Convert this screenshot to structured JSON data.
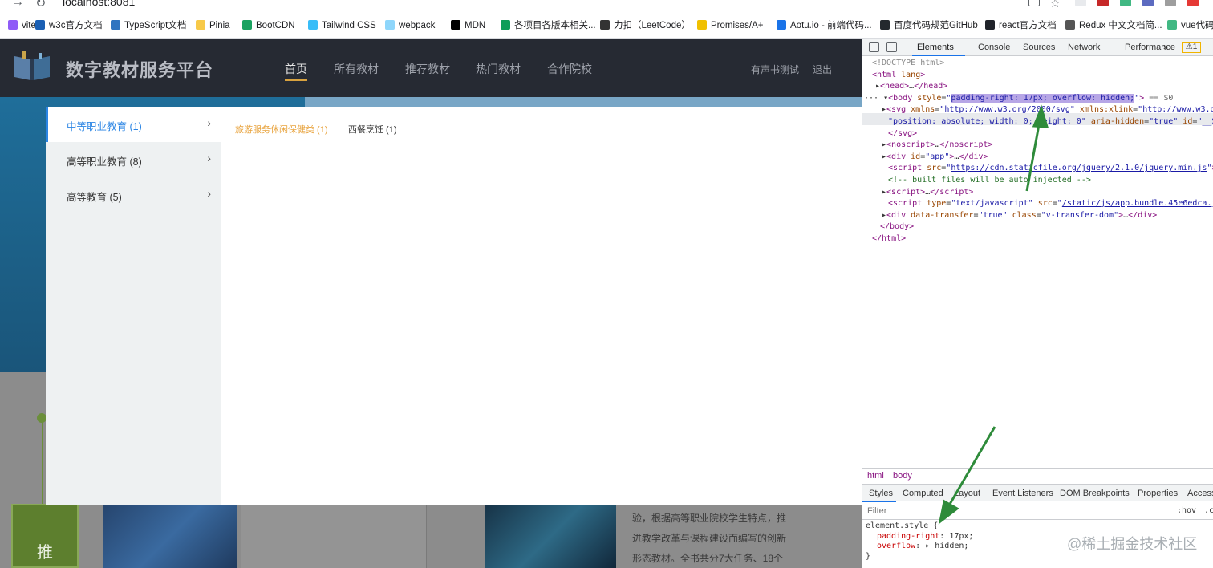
{
  "browser": {
    "url": "localhost:8081",
    "bookmarks": [
      {
        "label": "vite",
        "icon": "vite-icon",
        "color": "#8f5cf7"
      },
      {
        "label": "w3c官方文档",
        "icon": "w3c-icon",
        "color": "#1a5fb4"
      },
      {
        "label": "TypeScript文档",
        "icon": "typescript-icon",
        "color": "#2f74c0"
      },
      {
        "label": "Pinia",
        "icon": "pinia-icon",
        "color": "#f7c948"
      },
      {
        "label": "BootCDN",
        "icon": "bootcdn-icon",
        "color": "#1aa260"
      },
      {
        "label": "Tailwind CSS",
        "icon": "tailwind-icon",
        "color": "#38bdf8"
      },
      {
        "label": "webpack",
        "icon": "webpack-icon",
        "color": "#8ed6fb"
      },
      {
        "label": "MDN",
        "icon": "mdn-icon",
        "color": "#000000"
      },
      {
        "label": "各项目各版本相关...",
        "icon": "sheet-icon",
        "color": "#0f9d58"
      },
      {
        "label": "力扣（LeetCode）",
        "icon": "leetcode-icon",
        "color": "#333333"
      },
      {
        "label": "Promises/A+",
        "icon": "promises-icon",
        "color": "#f0c000"
      },
      {
        "label": "Aotu.io - 前端代码...",
        "icon": "aotu-icon",
        "color": "#1a73e8"
      },
      {
        "label": "百度代码规范GitHub",
        "icon": "github-icon",
        "color": "#24292e"
      },
      {
        "label": "react官方文档",
        "icon": "react-icon",
        "color": "#20232a"
      },
      {
        "label": "Redux 中文文档简...",
        "icon": "redux-icon",
        "color": "#555555"
      },
      {
        "label": "vue代码",
        "icon": "vue-icon",
        "color": "#41b883"
      }
    ]
  },
  "site": {
    "title": "数字教材服务平台",
    "nav": [
      "首页",
      "所有教材",
      "推荐教材",
      "热门教材",
      "合作院校"
    ],
    "user": "有声书测试",
    "logout": "退出"
  },
  "menu": {
    "categories": [
      {
        "label": "中等职业教育 (1)",
        "arrow": "›"
      },
      {
        "label": "高等职业教育 (8)",
        "arrow": "›"
      },
      {
        "label": "高等教育 (5)",
        "arrow": "›"
      }
    ],
    "subcategories": [
      "旅游服务休闲保健类 (1)",
      "西餐烹饪 (1)"
    ]
  },
  "background": {
    "badge": "推",
    "desc_lines": [
      "验，根据高等职业院校学生特点，推",
      "进教学改革与课程建设而编写的创新",
      "形态教材。全书共分7大任务、18个"
    ]
  },
  "devtools": {
    "tabs": [
      "Elements",
      "Console",
      "Sources",
      "Network",
      "Performance",
      "»"
    ],
    "warn_count": "1",
    "crumbs": [
      "html",
      "body"
    ],
    "subtabs": [
      "Styles",
      "Computed",
      "Layout",
      "Event Listeners",
      "DOM Breakpoints",
      "Properties",
      "Accessi"
    ],
    "filter_placeholder": "Filter",
    "hov": ":hov",
    "cls": ".cl",
    "rule_selector": "element.style {",
    "rule_props": [
      {
        "name": "padding-right",
        "value": "17px;"
      },
      {
        "name": "overflow",
        "value": "▸ hidden;"
      }
    ],
    "rule_close": "}"
  },
  "watermark": "@稀土掘金技术社区",
  "colors": {
    "header_bg": "#262a33",
    "banner": "#1f6e9a",
    "active_blue": "#2b85e4",
    "highlight_orange": "#e8a33d",
    "arrow_green": "#2e8b3a"
  }
}
